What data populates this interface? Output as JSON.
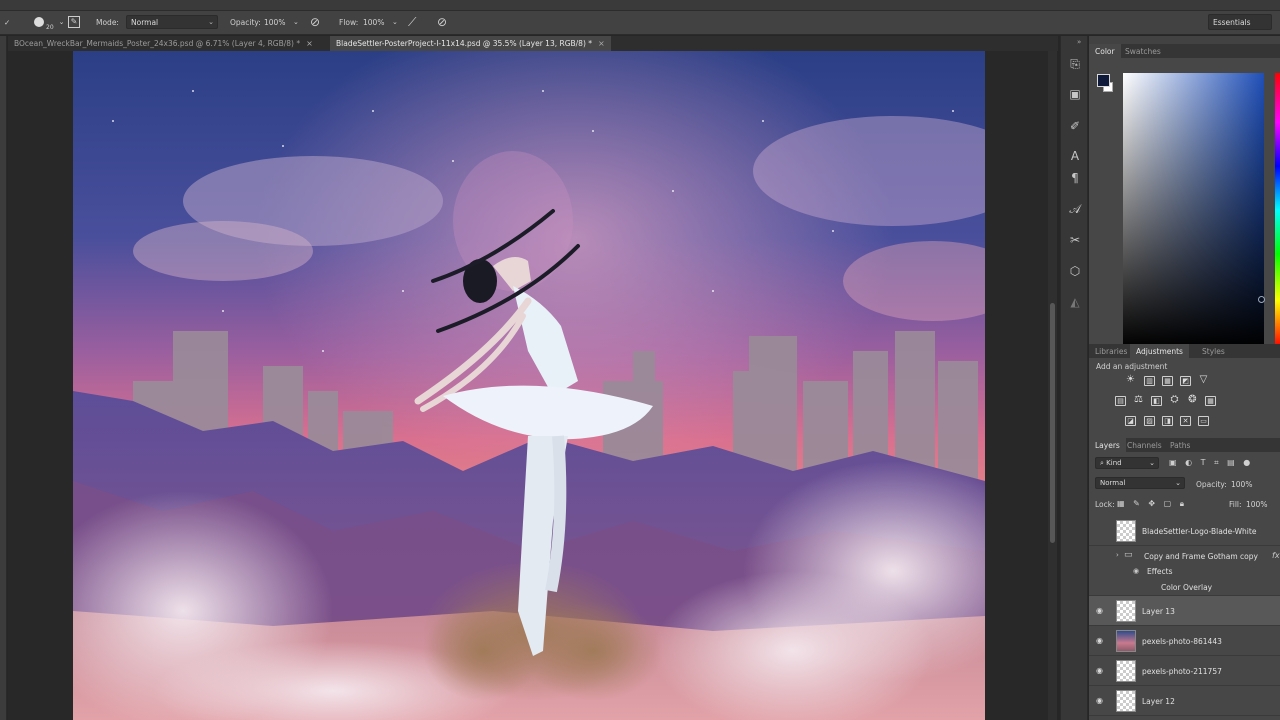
{
  "options_bar": {
    "brush_size": "20",
    "mode_label": "Mode:",
    "mode_value": "Normal",
    "opacity_label": "Opacity:",
    "opacity_value": "100%",
    "flow_label": "Flow:",
    "flow_value": "100%",
    "workspace": "Essentials"
  },
  "document_tabs": [
    {
      "label": "BOcean_WreckBar_Mermaids_Poster_24x36.psd @ 6.71% (Layer 4, RGB/8) *",
      "active": false
    },
    {
      "label": "BladeSettler-PosterProject-I-11x14.psd @ 35.5% (Layer 13, RGB/8) *",
      "active": true
    }
  ],
  "color_panel": {
    "tabs": [
      "Color",
      "Swatches"
    ],
    "foreground": "#0f1a3a",
    "background": "#ffffff"
  },
  "adjustments_panel": {
    "tabs": [
      "Libraries",
      "Adjustments",
      "Styles"
    ],
    "title": "Add an adjustment"
  },
  "layers_panel": {
    "tabs": [
      "Layers",
      "Channels",
      "Paths"
    ],
    "filter_kind": "Kind",
    "blend_mode": "Normal",
    "opacity_label": "Opacity:",
    "opacity_value": "100%",
    "lock_label": "Lock:",
    "fill_label": "Fill:",
    "fill_value": "100%",
    "layers": [
      {
        "name": "BladeSettler-Logo-Blade-White",
        "visible": false,
        "thumb": "checker"
      },
      {
        "name": "Copy and Frame Gotham copy",
        "visible": false,
        "group": true
      },
      {
        "name": "Effects",
        "effect": true
      },
      {
        "name": "Color Overlay",
        "effect": true
      },
      {
        "name": "Layer 13",
        "visible": true,
        "thumb": "checker",
        "selected": true
      },
      {
        "name": "pexels-photo-861443",
        "visible": true,
        "thumb": "photo"
      },
      {
        "name": "pexels-photo-211757",
        "visible": true,
        "thumb": "checker"
      },
      {
        "name": "Layer 12",
        "visible": true,
        "thumb": "checker"
      }
    ]
  },
  "accent_colors": {
    "panel_bg": "#474747",
    "selected_layer": "#585858",
    "sky_top": "#2b3f86",
    "sky_pink": "#d9708f"
  }
}
